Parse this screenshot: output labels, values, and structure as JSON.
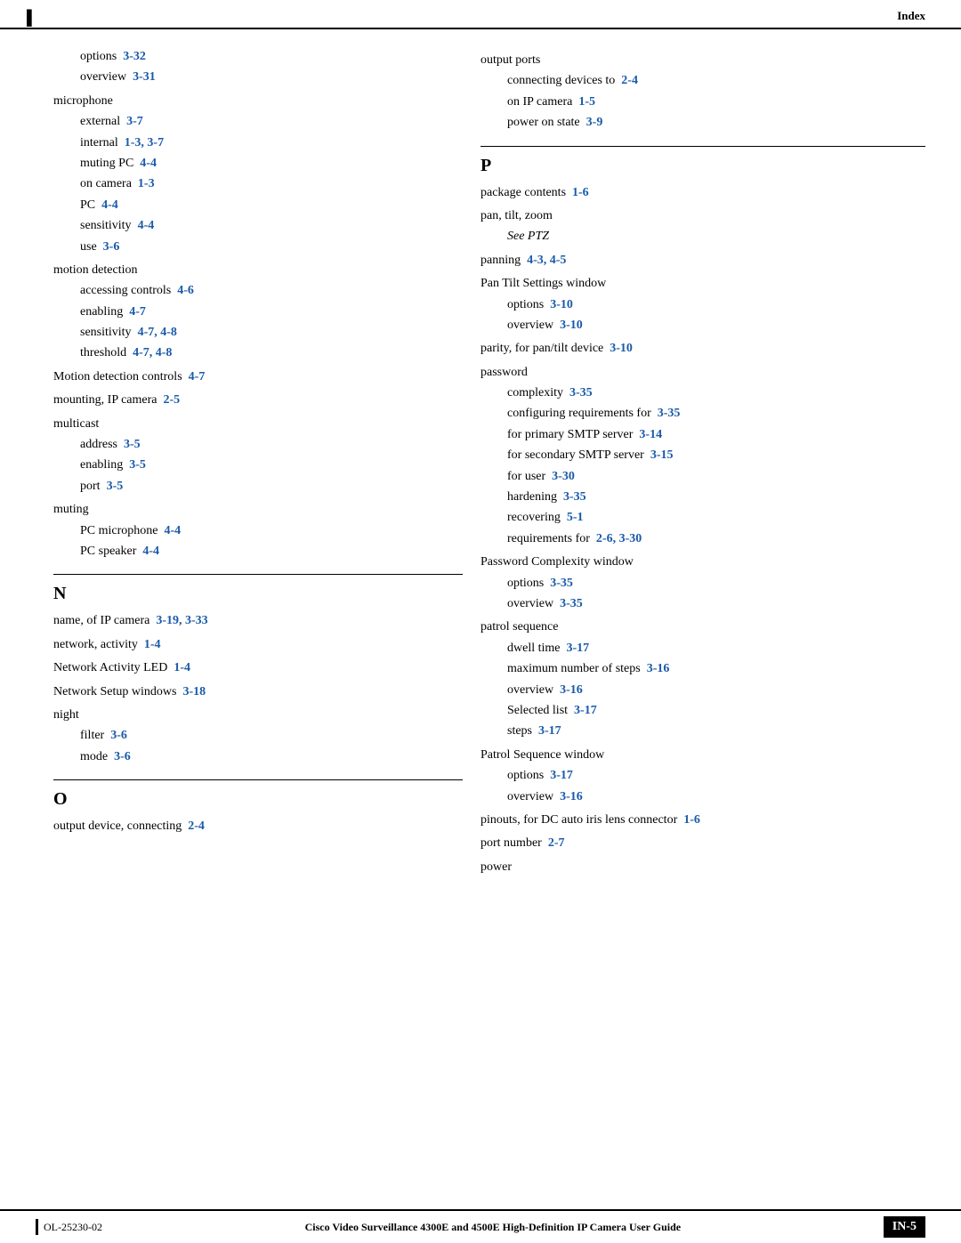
{
  "header": {
    "right_label": "Index",
    "left_bar": "▌"
  },
  "left_column": {
    "sections": [
      {
        "type": "entries",
        "items": [
          {
            "level": 1,
            "text": "options",
            "ref": "3-32"
          },
          {
            "level": 1,
            "text": "overview",
            "ref": "3-31"
          },
          {
            "level": 0,
            "text": "microphone",
            "ref": ""
          },
          {
            "level": 1,
            "text": "external",
            "ref": "3-7"
          },
          {
            "level": 1,
            "text": "internal",
            "ref": "1-3, 3-7"
          },
          {
            "level": 1,
            "text": "muting PC",
            "ref": "4-4"
          },
          {
            "level": 1,
            "text": "on camera",
            "ref": "1-3"
          },
          {
            "level": 1,
            "text": "PC",
            "ref": "4-4"
          },
          {
            "level": 1,
            "text": "sensitivity",
            "ref": "4-4"
          },
          {
            "level": 1,
            "text": "use",
            "ref": "3-6"
          },
          {
            "level": 0,
            "text": "motion detection",
            "ref": ""
          },
          {
            "level": 1,
            "text": "accessing controls",
            "ref": "4-6"
          },
          {
            "level": 1,
            "text": "enabling",
            "ref": "4-7"
          },
          {
            "level": 1,
            "text": "sensitivity",
            "ref": "4-7, 4-8"
          },
          {
            "level": 1,
            "text": "threshold",
            "ref": "4-7, 4-8"
          },
          {
            "level": 0,
            "text": "Motion detection controls",
            "ref": "4-7"
          },
          {
            "level": 0,
            "text": "mounting, IP camera",
            "ref": "2-5"
          },
          {
            "level": 0,
            "text": "multicast",
            "ref": ""
          },
          {
            "level": 1,
            "text": "address",
            "ref": "3-5"
          },
          {
            "level": 1,
            "text": "enabling",
            "ref": "3-5"
          },
          {
            "level": 1,
            "text": "port",
            "ref": "3-5"
          },
          {
            "level": 0,
            "text": "muting",
            "ref": ""
          },
          {
            "level": 1,
            "text": "PC microphone",
            "ref": "4-4"
          },
          {
            "level": 1,
            "text": "PC speaker",
            "ref": "4-4"
          }
        ]
      },
      {
        "type": "section",
        "letter": "N",
        "items": [
          {
            "level": 0,
            "text": "name, of IP camera",
            "ref": "3-19, 3-33"
          },
          {
            "level": 0,
            "text": "network, activity",
            "ref": "1-4"
          },
          {
            "level": 0,
            "text": "Network Activity LED",
            "ref": "1-4"
          },
          {
            "level": 0,
            "text": "Network Setup windows",
            "ref": "3-18"
          },
          {
            "level": 0,
            "text": "night",
            "ref": ""
          },
          {
            "level": 1,
            "text": "filter",
            "ref": "3-6"
          },
          {
            "level": 1,
            "text": "mode",
            "ref": "3-6"
          }
        ]
      },
      {
        "type": "section",
        "letter": "O",
        "items": [
          {
            "level": 0,
            "text": "output device, connecting",
            "ref": "2-4"
          }
        ]
      }
    ]
  },
  "right_column": {
    "sections": [
      {
        "type": "entries",
        "items": [
          {
            "level": 0,
            "text": "output ports",
            "ref": ""
          },
          {
            "level": 1,
            "text": "connecting devices to",
            "ref": "2-4"
          },
          {
            "level": 1,
            "text": "on IP camera",
            "ref": "1-5"
          },
          {
            "level": 1,
            "text": "power on state",
            "ref": "3-9"
          }
        ]
      },
      {
        "type": "section",
        "letter": "P",
        "items": [
          {
            "level": 0,
            "text": "package contents",
            "ref": "1-6"
          },
          {
            "level": 0,
            "text": "pan, tilt, zoom",
            "ref": ""
          },
          {
            "level": 1,
            "text": "See PTZ",
            "ref": "",
            "see": true
          },
          {
            "level": 0,
            "text": "panning",
            "ref": "4-3, 4-5"
          },
          {
            "level": 0,
            "text": "Pan Tilt Settings window",
            "ref": ""
          },
          {
            "level": 1,
            "text": "options",
            "ref": "3-10"
          },
          {
            "level": 1,
            "text": "overview",
            "ref": "3-10"
          },
          {
            "level": 0,
            "text": "parity, for pan/tilt device",
            "ref": "3-10"
          },
          {
            "level": 0,
            "text": "password",
            "ref": ""
          },
          {
            "level": 1,
            "text": "complexity",
            "ref": "3-35"
          },
          {
            "level": 1,
            "text": "configuring requirements for",
            "ref": "3-35"
          },
          {
            "level": 1,
            "text": "for primary SMTP server",
            "ref": "3-14"
          },
          {
            "level": 1,
            "text": "for secondary SMTP server",
            "ref": "3-15"
          },
          {
            "level": 1,
            "text": "for user",
            "ref": "3-30"
          },
          {
            "level": 1,
            "text": "hardening",
            "ref": "3-35"
          },
          {
            "level": 1,
            "text": "recovering",
            "ref": "5-1"
          },
          {
            "level": 1,
            "text": "requirements for",
            "ref": "2-6, 3-30"
          },
          {
            "level": 0,
            "text": "Password Complexity window",
            "ref": ""
          },
          {
            "level": 1,
            "text": "options",
            "ref": "3-35"
          },
          {
            "level": 1,
            "text": "overview",
            "ref": "3-35"
          },
          {
            "level": 0,
            "text": "patrol sequence",
            "ref": ""
          },
          {
            "level": 1,
            "text": "dwell time",
            "ref": "3-17"
          },
          {
            "level": 1,
            "text": "maximum number of steps",
            "ref": "3-16"
          },
          {
            "level": 1,
            "text": "overview",
            "ref": "3-16"
          },
          {
            "level": 1,
            "text": "Selected list",
            "ref": "3-17"
          },
          {
            "level": 1,
            "text": "steps",
            "ref": "3-17"
          },
          {
            "level": 0,
            "text": "Patrol Sequence window",
            "ref": ""
          },
          {
            "level": 1,
            "text": "options",
            "ref": "3-17"
          },
          {
            "level": 1,
            "text": "overview",
            "ref": "3-16"
          },
          {
            "level": 0,
            "text": "pinouts, for DC auto iris lens connector",
            "ref": "1-6"
          },
          {
            "level": 0,
            "text": "port number",
            "ref": "2-7"
          },
          {
            "level": 0,
            "text": "power",
            "ref": ""
          }
        ]
      }
    ]
  },
  "footer": {
    "doc_number": "OL-25230-02",
    "title": "Cisco Video Surveillance 4300E and 4500E High-Definition IP Camera User Guide",
    "page": "IN-5"
  }
}
